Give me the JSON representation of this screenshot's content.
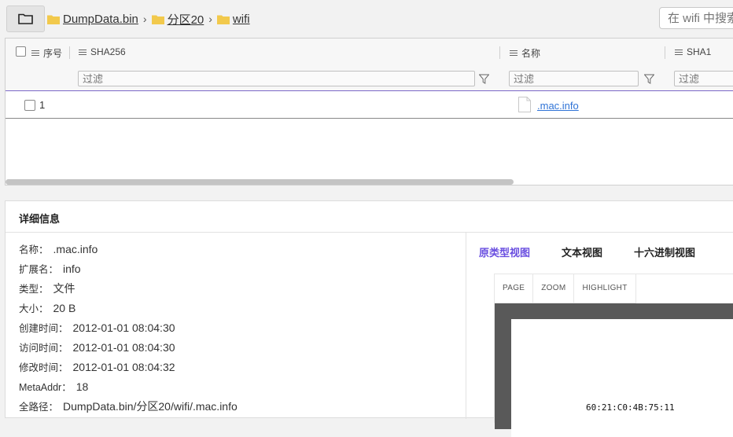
{
  "breadcrumb": {
    "items": [
      "DumpData.bin",
      "分区20",
      "wifi"
    ],
    "separator": "›"
  },
  "search": {
    "placeholder": "在 wifi 中搜索"
  },
  "grid": {
    "columns": [
      "序号",
      "SHA256",
      "名称",
      "SHA1"
    ],
    "filter_placeholder": "过滤",
    "rows": [
      {
        "index": "1",
        "name": ".mac.info"
      }
    ]
  },
  "details": {
    "title": "详细信息",
    "props": [
      {
        "label": "名称：",
        "value": ".mac.info"
      },
      {
        "label": "扩展名：",
        "value": "info"
      },
      {
        "label": "类型：",
        "value": "文件"
      },
      {
        "label": "大小：",
        "value": "20 B"
      },
      {
        "label": "创建时间：",
        "value": "2012-01-01 08:04:30"
      },
      {
        "label": "访问时间：",
        "value": "2012-01-01 08:04:30"
      },
      {
        "label": "修改时间：",
        "value": "2012-01-01 08:04:32"
      },
      {
        "label": "MetaAddr：",
        "value": "18"
      },
      {
        "label": "全路径：",
        "value": "DumpData.bin/分区20/wifi/.mac.info"
      }
    ],
    "view_tabs": [
      "原类型视图",
      "文本视图",
      "十六进制视图"
    ],
    "active_tab": 0,
    "viewer_tools": [
      "PAGE",
      "ZOOM",
      "HIGHLIGHT"
    ],
    "content_line": "60:21:C0:4B:75:11"
  },
  "colors": {
    "accent": "#6a4fe0",
    "link": "#2f73d6",
    "folder": "#f2c94c"
  }
}
